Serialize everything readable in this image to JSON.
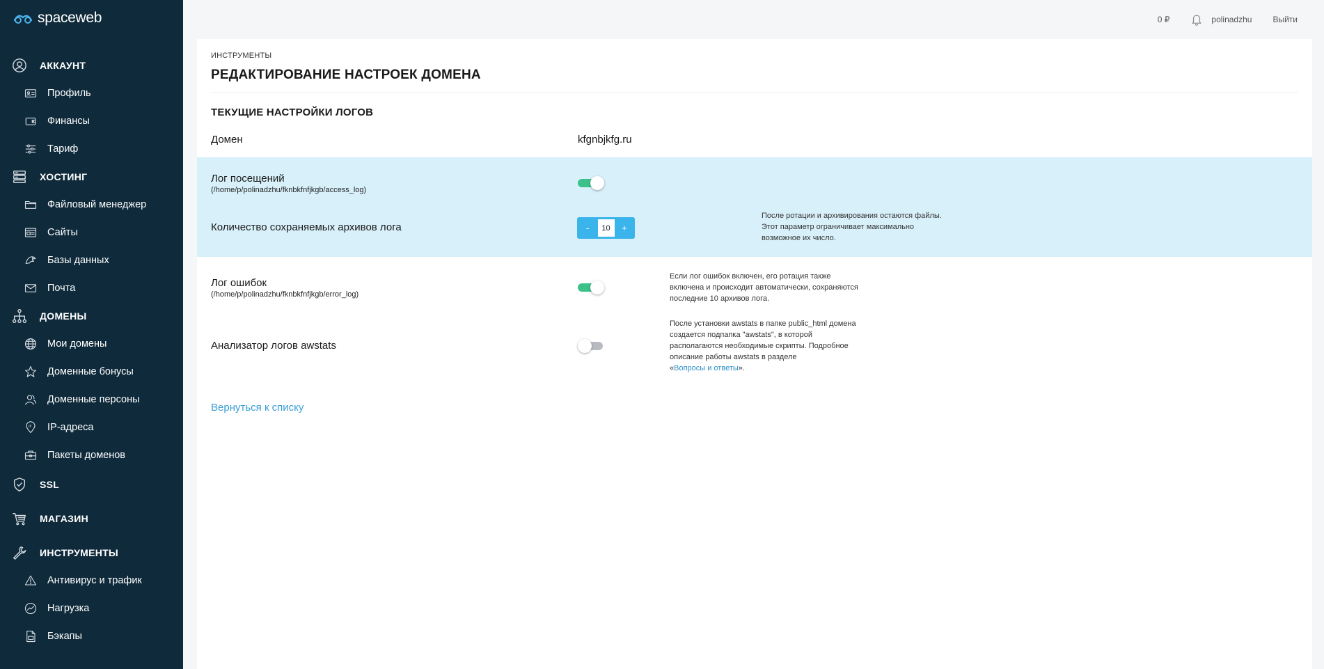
{
  "brand": {
    "name": "spaceweb"
  },
  "topbar": {
    "balance": "0 ₽",
    "username": "polinadzhu",
    "logout": "Выйти"
  },
  "sidebar": {
    "sections": [
      {
        "label": "АККАУНТ",
        "icon": "user-circle-icon",
        "items": [
          {
            "label": "Профиль",
            "icon": "id-card-icon"
          },
          {
            "label": "Финансы",
            "icon": "wallet-icon"
          },
          {
            "label": "Тариф",
            "icon": "sliders-icon"
          }
        ]
      },
      {
        "label": "ХОСТИНГ",
        "icon": "server-icon",
        "items": [
          {
            "label": "Файловый менеджер",
            "icon": "folder-icon"
          },
          {
            "label": "Сайты",
            "icon": "browser-window-icon"
          },
          {
            "label": "Базы данных",
            "icon": "database-icon"
          },
          {
            "label": "Почта",
            "icon": "envelope-icon"
          }
        ]
      },
      {
        "label": "ДОМЕНЫ",
        "icon": "sitemap-icon",
        "items": [
          {
            "label": "Мои домены",
            "icon": "globe-icon"
          },
          {
            "label": "Доменные бонусы",
            "icon": "star-icon"
          },
          {
            "label": "Доменные персоны",
            "icon": "users-icon"
          },
          {
            "label": "IP-адреса",
            "icon": "location-pin-icon"
          },
          {
            "label": "Пакеты доменов",
            "icon": "briefcase-icon"
          }
        ]
      },
      {
        "label": "SSL",
        "icon": "shield-check-icon",
        "items": []
      },
      {
        "label": "МАГАЗИН",
        "icon": "cart-icon",
        "items": []
      },
      {
        "label": "ИНСТРУМЕНТЫ",
        "icon": "wrench-icon",
        "items": [
          {
            "label": "Антивирус и трафик",
            "icon": "warning-triangle-icon"
          },
          {
            "label": "Нагрузка",
            "icon": "gauge-icon"
          },
          {
            "label": "Бэкапы",
            "icon": "document-icon"
          }
        ]
      }
    ]
  },
  "page": {
    "breadcrumb": "ИНСТРУМЕНТЫ",
    "title": "РЕДАКТИРОВАНИЕ НАСТРОЕК ДОМЕНА",
    "section_title": "ТЕКУЩИЕ НАСТРОЙКИ ЛОГОВ",
    "domain_label": "Домен",
    "domain_value": "kfgnbjkfg.ru",
    "access_log": {
      "label": "Лог посещений",
      "path": "(/home/p/polinadzhu/fknbkfnfjkgb/access_log)",
      "enabled": true
    },
    "archives": {
      "label": "Количество сохраняемых архивов лога",
      "value": "10",
      "minus": "-",
      "plus": "+",
      "note": [
        "После ротации и архивирования остаются файлы.",
        "Этот параметр ограничивает максимально",
        "возможное их число."
      ]
    },
    "error_log": {
      "label": "Лог ошибок",
      "path": "(/home/p/polinadzhu/fknbkfnfjkgb/error_log)",
      "enabled": true,
      "note": [
        "Если лог ошибок включен, его ротация также",
        "включена и происходит автоматически, сохраняются",
        "последние 10 архивов лога."
      ]
    },
    "awstats": {
      "label": "Анализатор логов awstats",
      "enabled": false,
      "note": [
        "После установки awstats в папке public_html домена",
        "создается подпапка \"awstats\", в которой",
        "располагаются необходимые скрипты. Подробное",
        "описание работы awstats в разделе"
      ],
      "note_prefix": "«",
      "note_link": "Вопросы и ответы",
      "note_suffix": "»."
    },
    "back_link": "Вернуться к списку"
  },
  "colors": {
    "sidebar": "#0f2a3b",
    "accent": "#3ab4ea",
    "toggle_on": "#3cc18a",
    "band": "#d8f0f9",
    "link": "#3a9fd6"
  }
}
